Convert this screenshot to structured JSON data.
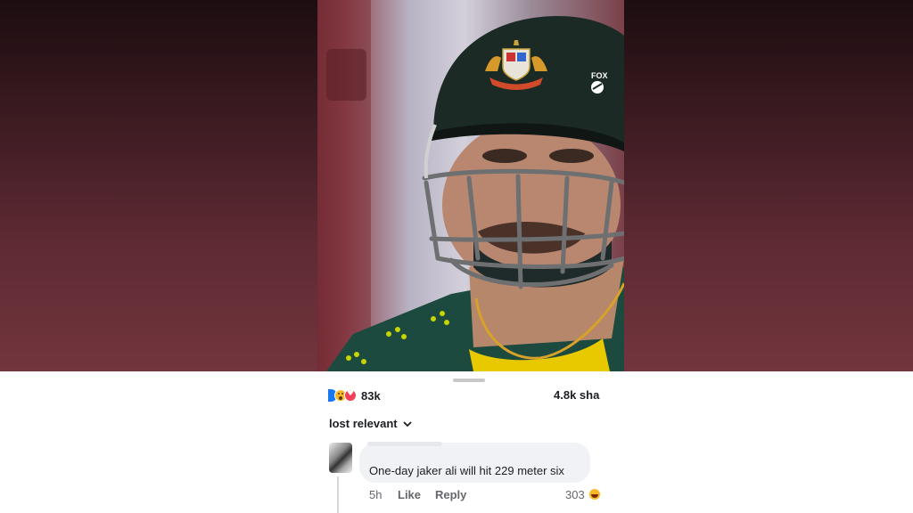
{
  "video": {
    "watermark": "FOX",
    "background_color": "#c9c6d2",
    "jersey_color": "#1d4a3e",
    "helmet_color": "#1c2a26"
  },
  "reactions": {
    "icons": [
      "like-icon",
      "wow-icon",
      "love-icon"
    ],
    "count": "83k"
  },
  "shares": {
    "label": "4.8k sha"
  },
  "comments": {
    "sort_label": "lost relevant",
    "items": [
      {
        "avatar": "avatar-image",
        "text": "One-day jaker ali will hit 229 meter six",
        "time": "5h",
        "like_label": "Like",
        "reply_label": "Reply",
        "reaction_count": "303",
        "reaction_icon": "haha-icon"
      }
    ]
  }
}
